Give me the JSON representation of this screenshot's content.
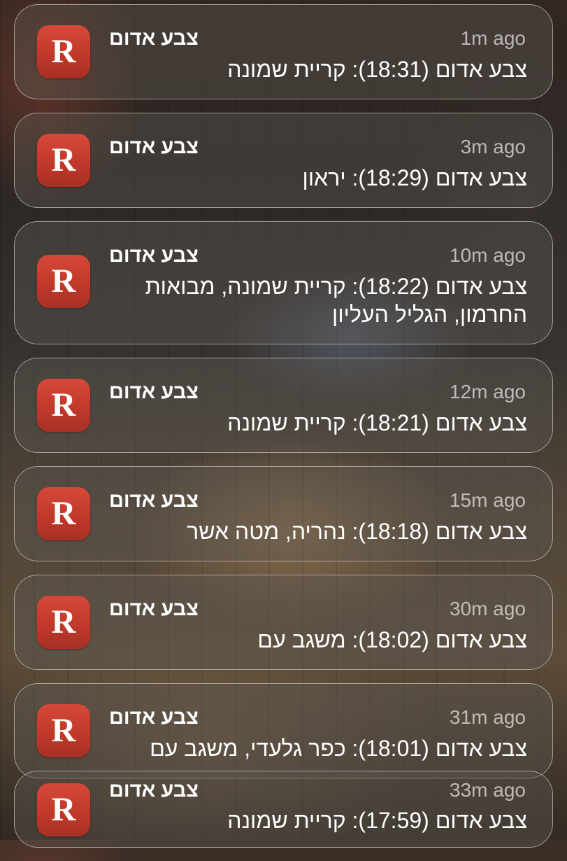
{
  "notifications": [
    {
      "app": "צבע אדום",
      "time": "1m ago",
      "text": "צבע אדום (18:31): קריית שמונה",
      "icon_letter": "R"
    },
    {
      "app": "צבע אדום",
      "time": "3m ago",
      "text": "צבע אדום (18:29): יראון",
      "icon_letter": "R"
    },
    {
      "app": "צבע אדום",
      "time": "10m ago",
      "text": "צבע אדום (18:22): קריית שמונה, מבואות החרמון, הגליל העליון",
      "icon_letter": "R"
    },
    {
      "app": "צבע אדום",
      "time": "12m ago",
      "text": "צבע אדום (18:21): קריית שמונה",
      "icon_letter": "R"
    },
    {
      "app": "צבע אדום",
      "time": "15m ago",
      "text": "צבע אדום (18:18): נהריה, מטה אשר",
      "icon_letter": "R"
    },
    {
      "app": "צבע אדום",
      "time": "30m ago",
      "text": "צבע אדום (18:02): משגב עם",
      "icon_letter": "R"
    },
    {
      "app": "צבע אדום",
      "time": "31m ago",
      "text": "צבע אדום (18:01): כפר גלעדי, משגב עם",
      "icon_letter": "R"
    },
    {
      "app": "צבע אדום",
      "time": "33m ago",
      "text": "צבע אדום (17:59): קריית שמונה",
      "icon_letter": "R"
    }
  ],
  "colors": {
    "icon_red": "#c0392b",
    "icon_letter": "#ffffff",
    "text_primary": "#ffffff",
    "text_secondary": "#c8c4c0"
  },
  "icons": {
    "app_icon": "red-alert-app-icon"
  }
}
